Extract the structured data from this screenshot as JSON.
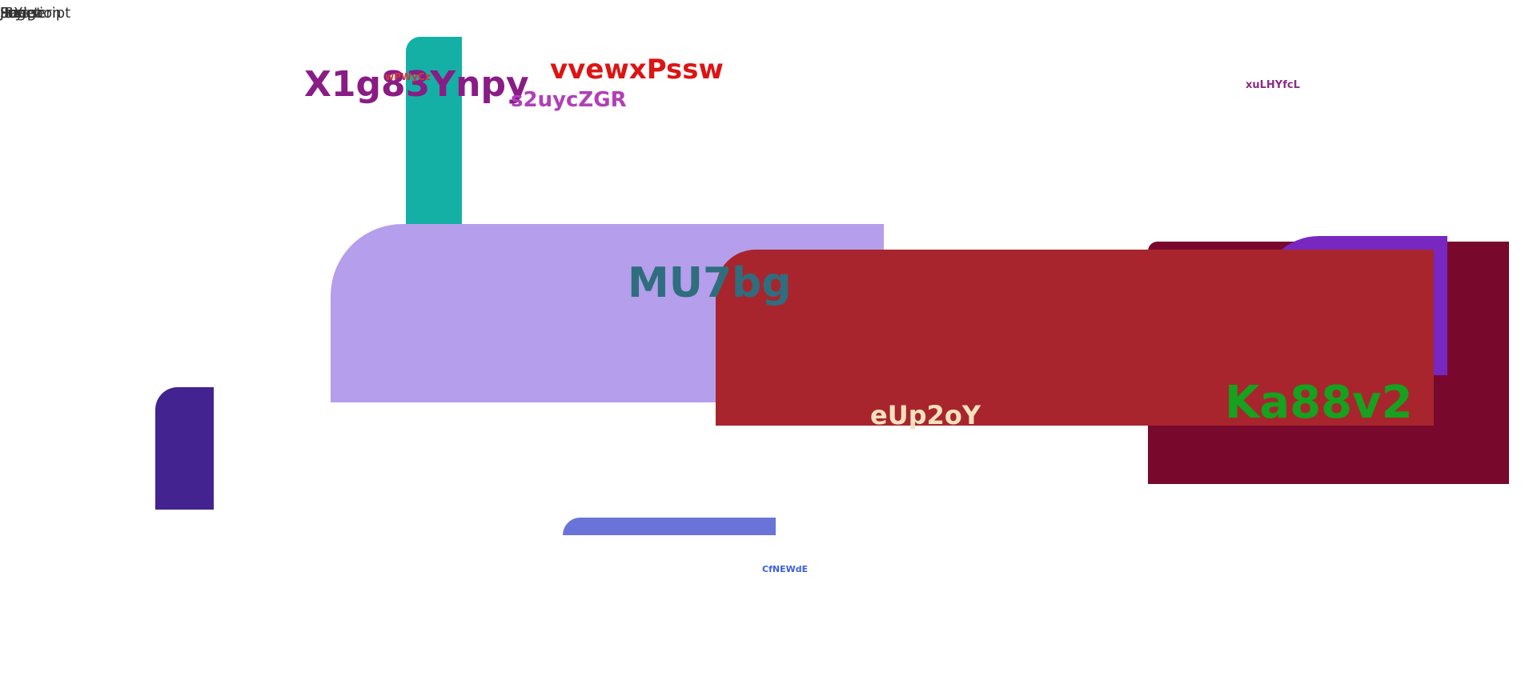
{
  "corner_text": [
    "Javascript",
    "Function",
    "Image",
    "Page",
    "Script",
    "Style",
    "JSX"
  ],
  "shapes": [
    {
      "id": "shape-teal",
      "color": "#14b0a6"
    },
    {
      "id": "shape-lavender",
      "color": "#b59eec"
    },
    {
      "id": "shape-indigo",
      "color": "#42238f"
    },
    {
      "id": "shape-periwinkle",
      "color": "#6a74d8"
    },
    {
      "id": "shape-maroon",
      "color": "#79082d"
    },
    {
      "id": "shape-violet",
      "color": "#7828c0"
    },
    {
      "id": "shape-red",
      "color": "#a8252d"
    }
  ],
  "labels": {
    "x1g": {
      "text": "X1g83Ynpy",
      "color": "#8a1c86"
    },
    "tiny_red": {
      "text": "wPWyCz",
      "color": "#d03a3a"
    },
    "vvew": {
      "text": "vvewxPssw",
      "color": "#dd1414"
    },
    "s2uy": {
      "text": "s2uycZGR",
      "color": "#b040b8"
    },
    "xulh": {
      "text": "xuLHYfcL",
      "color": "#8a2d86"
    },
    "mu7": {
      "text": "MU7bg",
      "color": "#2e6e7e"
    },
    "eup": {
      "text": "eUp2oY",
      "color": "#f5e1bd"
    },
    "ka8": {
      "text": "Ka88v2",
      "color": "#16a11e"
    },
    "cfne": {
      "text": "CfNEWdE",
      "color": "#3b5fe0"
    }
  }
}
